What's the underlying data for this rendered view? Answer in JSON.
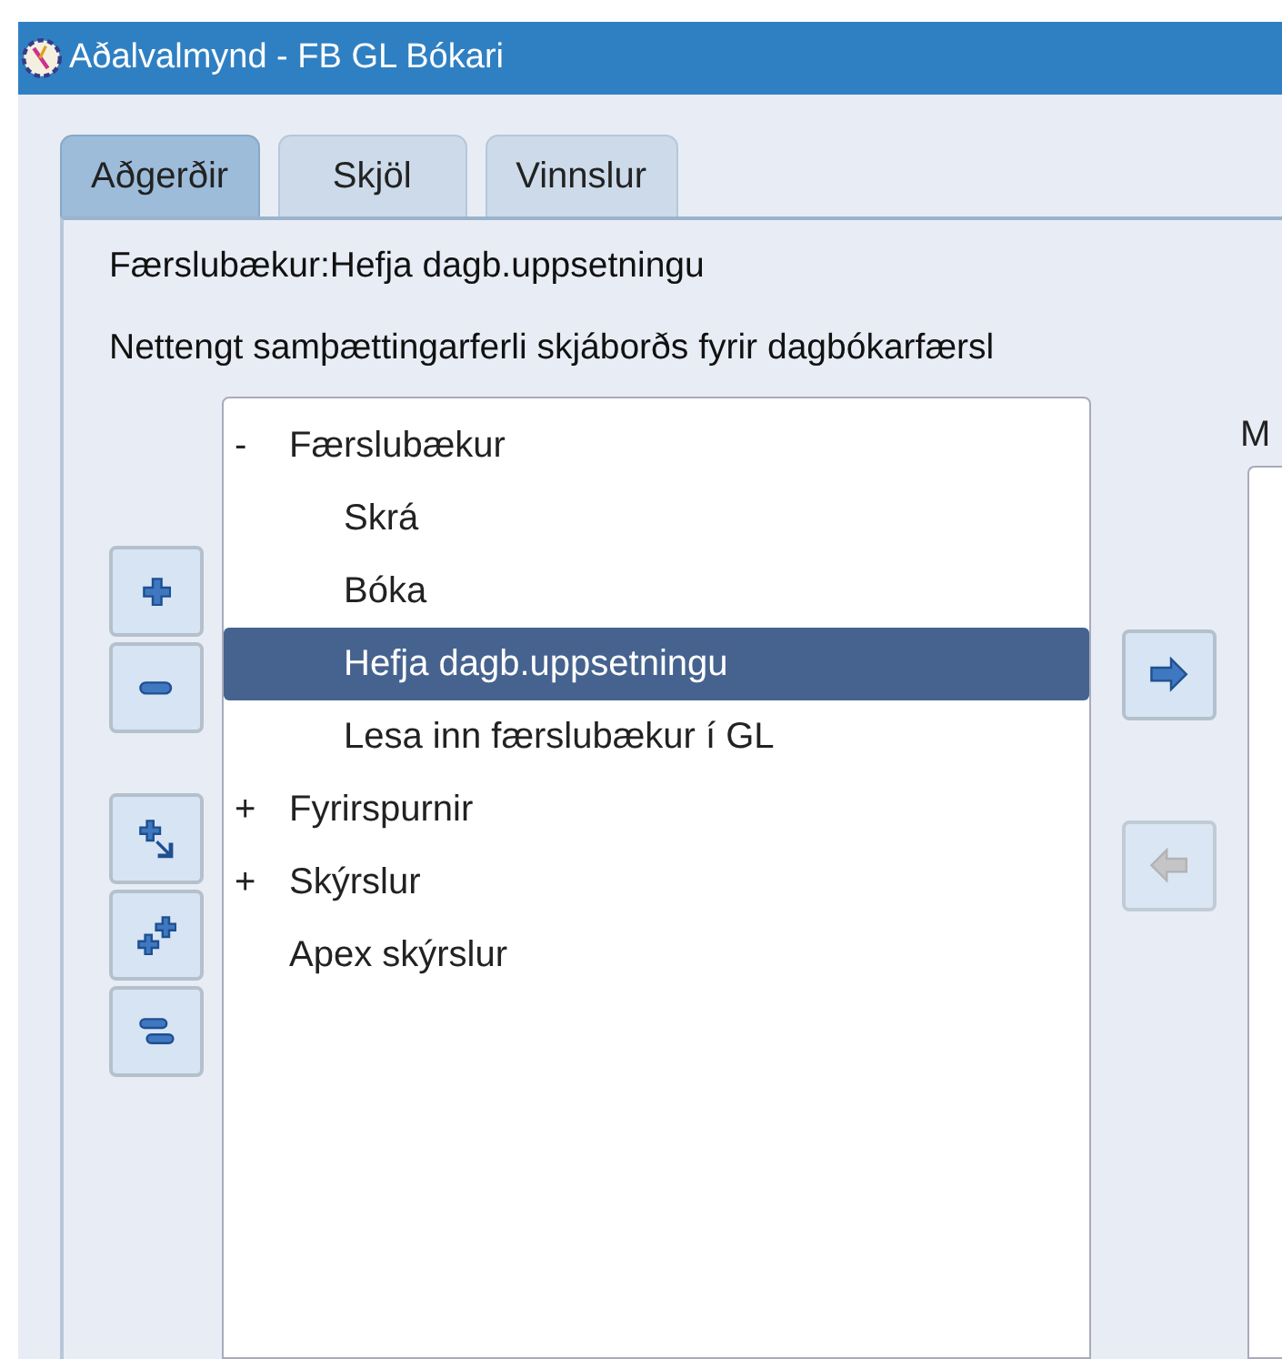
{
  "window": {
    "title": "Aðalvalmynd - FB GL Bókari"
  },
  "tabs": [
    {
      "label": "Aðgerðir",
      "selected": true
    },
    {
      "label": "Skjöl",
      "selected": false
    },
    {
      "label": "Vinnslur",
      "selected": false
    }
  ],
  "heading": "Færslubækur:Hefja dagb.uppsetningu",
  "description": "Nettengt samþættingarferli skjáborðs fyrir dagbókarfærsl",
  "tree_buttons": [
    {
      "kind": "expand"
    },
    {
      "kind": "collapse"
    },
    {
      "kind": "expand_branch"
    },
    {
      "kind": "expand_all"
    },
    {
      "kind": "collapse_all"
    }
  ],
  "tree": [
    {
      "toggle": "-",
      "label": "Færslubækur",
      "selected": false,
      "children": [
        {
          "label": "Skrá",
          "selected": false
        },
        {
          "label": "Bóka",
          "selected": false
        },
        {
          "label": "Hefja dagb.uppsetningu",
          "selected": true
        },
        {
          "label": "Lesa inn færslubækur í GL",
          "selected": false
        }
      ]
    },
    {
      "toggle": "+",
      "label": "Fyrirspurnir",
      "selected": false
    },
    {
      "toggle": "+",
      "label": "Skýrslur",
      "selected": false
    },
    {
      "label": "Apex skýrslur",
      "selected": false
    }
  ],
  "move_buttons": [
    {
      "kind": "right",
      "disabled": false
    },
    {
      "kind": "left",
      "disabled": true
    }
  ],
  "second_list": {
    "label": "M"
  }
}
